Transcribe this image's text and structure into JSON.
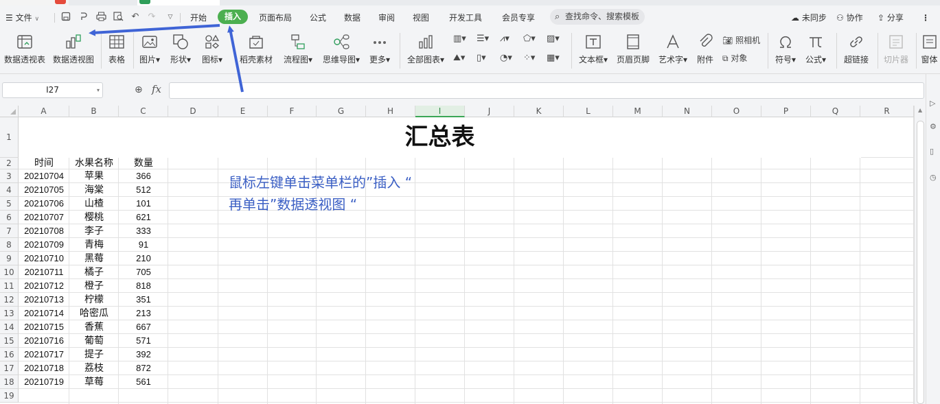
{
  "menubar": {
    "file_label": "文件",
    "tabs": [
      "开始",
      "插入",
      "页面布局",
      "公式",
      "数据",
      "审阅",
      "视图",
      "开发工具",
      "会员专享"
    ],
    "active_tab": "插入",
    "search_placeholder": "查找命令、搜索模板",
    "sync_label": "未同步",
    "collab_label": "协作",
    "share_label": "分享"
  },
  "ribbon": {
    "pivot_table": "数据透视表",
    "pivot_chart": "数据透视图",
    "table": "表格",
    "picture": "图片",
    "shape": "形状",
    "icon": "图标",
    "material": "稻壳素材",
    "flowchart": "流程图",
    "mindmap": "思维导图",
    "more": "更多",
    "all_charts": "全部图表",
    "textbox": "文本框",
    "header_footer": "页眉页脚",
    "wordart": "艺术字",
    "attachment": "附件",
    "camera": "照相机",
    "object": "对象",
    "symbol": "符号",
    "formula": "公式",
    "hyperlink": "超链接",
    "slicer": "切片器",
    "window": "窗体"
  },
  "formula_bar": {
    "name_box": "I27",
    "fx_label": "fx",
    "value": ""
  },
  "sheet": {
    "columns": [
      "A",
      "B",
      "C",
      "D",
      "E",
      "F",
      "G",
      "H",
      "I",
      "J",
      "K",
      "L",
      "M",
      "N",
      "O",
      "P",
      "Q",
      "R"
    ],
    "selected_column": "I",
    "title": "汇总表",
    "headers": [
      "时间",
      "水果名称",
      "数量"
    ],
    "rows": [
      [
        "20210704",
        "苹果",
        "366"
      ],
      [
        "20210705",
        "海棠",
        "512"
      ],
      [
        "20210706",
        "山楂",
        "101"
      ],
      [
        "20210707",
        "樱桃",
        "621"
      ],
      [
        "20210708",
        "李子",
        "333"
      ],
      [
        "20210709",
        "青梅",
        "91"
      ],
      [
        "20210710",
        "黑莓",
        "210"
      ],
      [
        "20210711",
        "橘子",
        "705"
      ],
      [
        "20210712",
        "橙子",
        "818"
      ],
      [
        "20210713",
        "柠檬",
        "351"
      ],
      [
        "20210714",
        "哈密瓜",
        "213"
      ],
      [
        "20210715",
        "香蕉",
        "667"
      ],
      [
        "20210716",
        "葡萄",
        "571"
      ],
      [
        "20210717",
        "提子",
        "392"
      ],
      [
        "20210718",
        "荔枝",
        "872"
      ],
      [
        "20210719",
        "草莓",
        "561"
      ]
    ],
    "row_numbers": [
      "1",
      "2",
      "3",
      "4",
      "5",
      "6",
      "7",
      "8",
      "9",
      "10",
      "11",
      "12",
      "13",
      "14",
      "15",
      "16",
      "17",
      "18",
      "19"
    ]
  },
  "annotation": {
    "line1": "鼠标左键单击菜单栏的”插入 “",
    "line2": "再单击”数据透视图 “",
    "color": "#3b5fc4"
  },
  "colors": {
    "accent": "#4caf50",
    "arrow": "#3f64d6"
  }
}
